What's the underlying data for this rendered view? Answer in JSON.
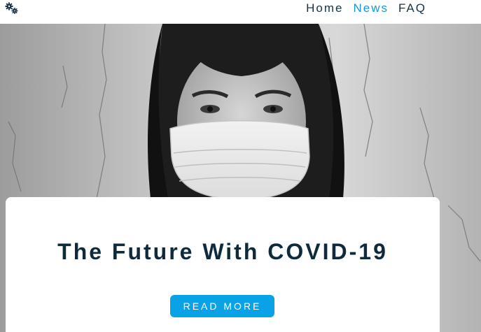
{
  "nav": {
    "logo_icon": "gears-icon",
    "links": [
      {
        "label": "Home",
        "active": false
      },
      {
        "label": "News",
        "active": true
      },
      {
        "label": "FAQ",
        "active": false
      }
    ]
  },
  "hero": {
    "image": "black-and-white photo of a woman wearing a surgical face mask against a cracked white wall"
  },
  "card": {
    "title": "The Future With COVID-19",
    "button_label": "READ MORE"
  },
  "colors": {
    "nav_text": "#163447",
    "nav_active": "#1597d6",
    "title": "#0f2a3b",
    "button": "#0aa2e6"
  }
}
